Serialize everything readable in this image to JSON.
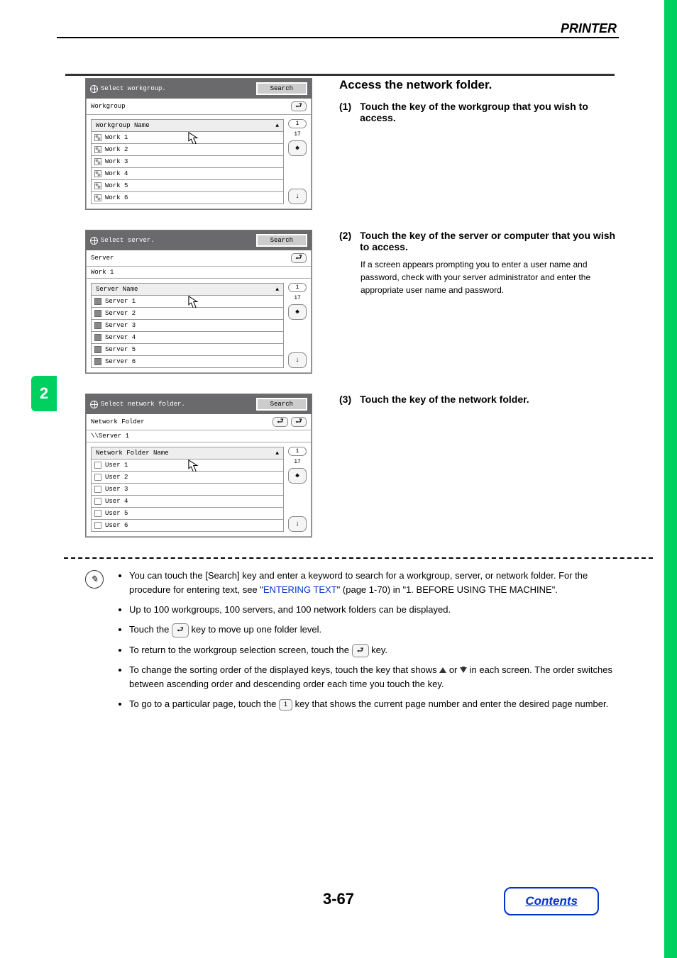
{
  "header": {
    "title": "PRINTER"
  },
  "tab": "2",
  "pageNumber": "3-67",
  "contentsLabel": "Contents",
  "panel1": {
    "prompt": "Select workgroup.",
    "search": "Search",
    "crumb": "Workgroup",
    "colHeader": "Workgroup Name",
    "items": [
      "Work 1",
      "Work 2",
      "Work 3",
      "Work 4",
      "Work 5",
      "Work 6"
    ],
    "page": "1",
    "total": "17"
  },
  "panel2": {
    "prompt": "Select server.",
    "search": "Search",
    "crumb": "Server",
    "sub": "Work 1",
    "colHeader": "Server Name",
    "items": [
      "Server 1",
      "Server 2",
      "Server 3",
      "Server 4",
      "Server 5",
      "Server 6"
    ],
    "page": "1",
    "total": "17"
  },
  "panel3": {
    "prompt": "Select network folder.",
    "search": "Search",
    "crumb": "Network Folder",
    "sub": "\\\\Server 1",
    "colHeader": "Network Folder Name",
    "items": [
      "User 1",
      "User 2",
      "User 3",
      "User 4",
      "User 5",
      "User 6"
    ],
    "page": "1",
    "total": "17"
  },
  "instr": {
    "heading": "Access the network folder.",
    "step1num": "(1)",
    "step1": "Touch the key of the workgroup that you wish to access.",
    "step2num": "(2)",
    "step2": "Touch the key of the server or computer that you wish to access.",
    "step2sub": "If a screen appears prompting you to enter a user name and password, check with your server administrator and enter the appropriate user name and password.",
    "step3num": "(3)",
    "step3": "Touch the key of the network folder."
  },
  "notes": {
    "b1a": "You can touch the [Search] key and enter a keyword to search for a workgroup, server, or network folder. For the procedure for entering text, see \"",
    "b1link": "ENTERING TEXT",
    "b1b": "\" (page 1-70) in \"1. BEFORE USING THE MACHINE\".",
    "b2": "Up to 100 workgroups, 100 servers, and 100 network folders can be displayed.",
    "b3a": "Touch the ",
    "b3b": " key to move up one folder level.",
    "b4a": "To return to the workgroup selection screen, touch the ",
    "b4b": " key.",
    "b5a": "To change the sorting order of the displayed keys, touch the key that shows ",
    "b5b": " or ",
    "b5c": " in each screen. The order switches between ascending order and descending order each time you touch the key.",
    "b6a": "To go to a particular page, touch the ",
    "b6page": "1",
    "b6b": " key that shows the current page number and enter the desired page number."
  }
}
